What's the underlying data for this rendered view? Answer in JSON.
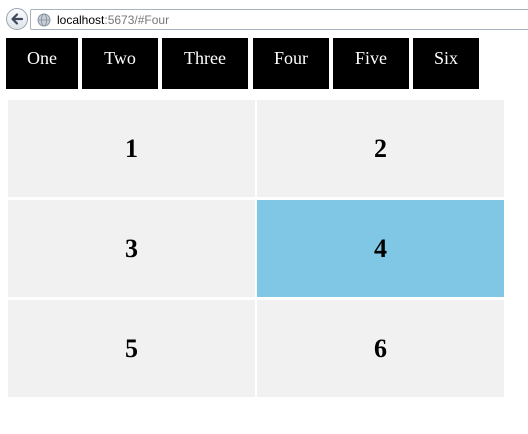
{
  "browser": {
    "url_host": "localhost",
    "url_rest": ":5673/#Four"
  },
  "nav": {
    "tabs": [
      {
        "label": "One"
      },
      {
        "label": "Two"
      },
      {
        "label": "Three"
      },
      {
        "label": "Four"
      },
      {
        "label": "Five"
      },
      {
        "label": "Six"
      }
    ]
  },
  "grid": {
    "cells": [
      {
        "label": "1",
        "active": false
      },
      {
        "label": "2",
        "active": false
      },
      {
        "label": "3",
        "active": false
      },
      {
        "label": "4",
        "active": true
      },
      {
        "label": "5",
        "active": false
      },
      {
        "label": "6",
        "active": false
      }
    ],
    "active_color": "#7fc7e5",
    "cell_color": "#f1f1f1"
  },
  "icons": {
    "back": "back-arrow-icon",
    "site": "globe-icon"
  }
}
